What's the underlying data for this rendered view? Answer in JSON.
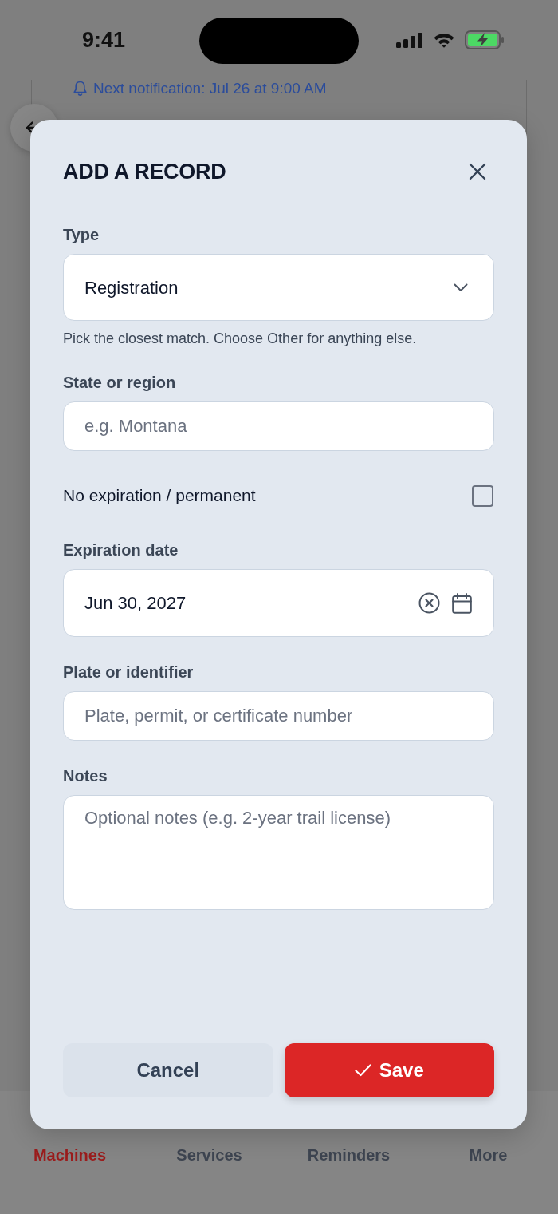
{
  "status_bar": {
    "time": "9:41"
  },
  "background": {
    "notification": "Next notification: Jul 26 at 9:00 AM"
  },
  "tab_bar": {
    "tabs": [
      {
        "label": "Machines",
        "selected": true
      },
      {
        "label": "Services",
        "selected": false
      },
      {
        "label": "Reminders",
        "selected": false
      },
      {
        "label": "More",
        "selected": false
      }
    ]
  },
  "dialog": {
    "title": "ADD A RECORD",
    "fields": [
      {
        "kind": "select",
        "label": "Type",
        "value": "Registration",
        "help": "Pick the closest match. Choose Other for anything else."
      },
      {
        "kind": "text",
        "label": "State or region",
        "placeholder": "e.g. Montana"
      },
      {
        "kind": "checkbox",
        "label": "No expiration / permanent",
        "checked": false
      },
      {
        "kind": "date",
        "label": "Expiration date",
        "value": "Jun 30, 2027"
      },
      {
        "kind": "text",
        "label": "Plate or identifier",
        "placeholder": "Plate, permit, or certificate number"
      },
      {
        "kind": "textarea",
        "label": "Notes",
        "placeholder": "Optional notes (e.g. 2-year trail license)"
      }
    ],
    "buttons": [
      {
        "kind": "secondary",
        "label": "Cancel"
      },
      {
        "kind": "primary",
        "label": "Save"
      }
    ]
  }
}
